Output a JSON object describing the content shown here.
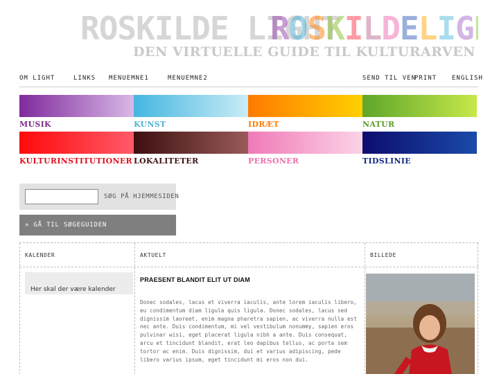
{
  "header": {
    "logo_text": "ROSKILDE LIGHT",
    "tagline": "DEN VIRTUELLE GUIDE TIL KULTURARVEN"
  },
  "topnav": {
    "items": [
      "OM LIGHT",
      "LINKS",
      "MENUEMNE1",
      "MENUEMNE2",
      "SEND TIL VEN",
      "PRINT",
      "ENGLISH"
    ]
  },
  "categories": [
    {
      "label": "MUSIK",
      "color_start": "#7f2a9c",
      "color_end": "#d9b8e6",
      "label_color": "#7a2b8c"
    },
    {
      "label": "KUNST",
      "color_start": "#45b6e0",
      "color_end": "#c9ecf6",
      "label_color": "#4fb3d6"
    },
    {
      "label": "IDRÆT",
      "color_start": "#ff7a00",
      "color_end": "#ffd000",
      "label_color": "#ff7a00"
    },
    {
      "label": "NATUR",
      "color_start": "#5ea62a",
      "color_end": "#c7e84a",
      "label_color": "#5a9a2a"
    },
    {
      "label": "KULTURINSTITUTIONER",
      "color_start": "#ff0a0a",
      "color_end": "#ff5a6a",
      "label_color": "#e01020"
    },
    {
      "label": "LOKALITETER",
      "color_start": "#3d0f0f",
      "color_end": "#9a5a5a",
      "label_color": "#3d1212"
    },
    {
      "label": "PERSONER",
      "color_start": "#f07ab8",
      "color_end": "#fbd3e6",
      "label_color": "#ee6fae"
    },
    {
      "label": "TIDSLINIE",
      "color_start": "#0d0d6e",
      "color_end": "#1a4aa8",
      "label_color": "#142a80"
    }
  ],
  "search": {
    "label": "SØG PÅ HJEMMESIDEN",
    "value": ""
  },
  "guide_button": {
    "label": "» GÅ TIL SØGEGUIDEN"
  },
  "columns": {
    "calendar": {
      "heading": "KALENDER",
      "text": "Her skal der være kalender"
    },
    "news": {
      "heading": "AKTUELT",
      "title": "PRAESENT BLANDIT ELIT UT DIAM",
      "body": "Donec sodales, lacus et viverra iaculis, ante lorem iaculis libero, eu condimentum diam ligula quis ligula. Donec sodales, lacus sed dignissim laoreet, enim magna pharetra sapien, ac viverra nulla est nec ante. Duis condimentum, mi vel vestibulum nonummy, sapien eros pulvinar wisi, eget placerat ligula nibh a ante. Duis consequat, arcu et tincidunt blandit, erat leo dapibus tellus, ac porta sem tortor ac enim. Duis dignissim, dui et varius adipiscing, pede libero varius ipsum, eget tincidunt mi eros non dui."
    },
    "image": {
      "heading": "BILLEDE"
    }
  },
  "colors": {
    "accent_gray": "#7f7f7f",
    "search_bg": "#e2e2e2"
  }
}
